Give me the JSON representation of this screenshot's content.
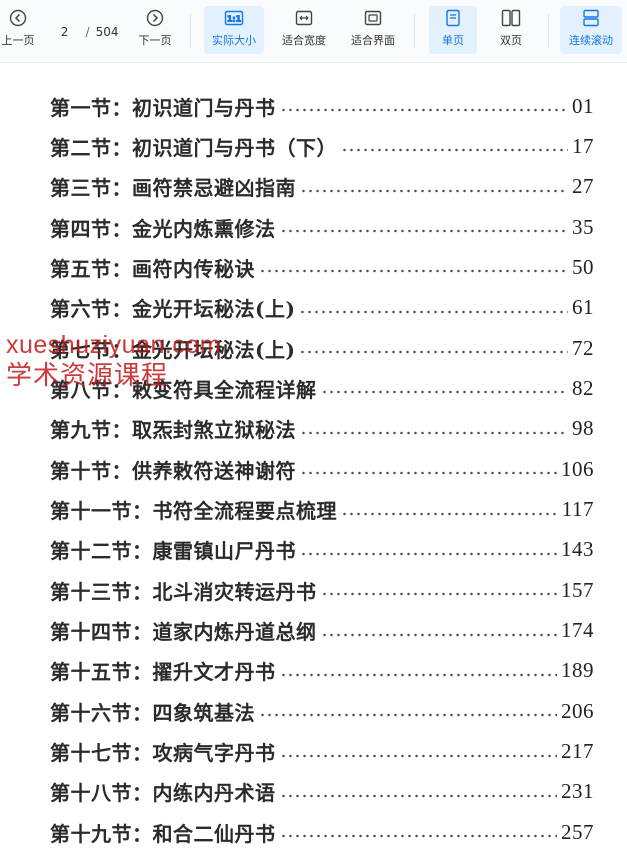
{
  "toolbar": {
    "prev_label": "上一页",
    "next_label": "下一页",
    "current_page": "2",
    "page_separator": "/",
    "total_pages": "504",
    "actual_size_label": "实际大小",
    "actual_size_glyph": "1:1",
    "fit_width_label": "适合宽度",
    "fit_page_label": "适合界面",
    "single_page_label": "单页",
    "double_page_label": "双页",
    "continuous_label": "连续滚动"
  },
  "toc": [
    {
      "title": "第一节：初识道门与丹书",
      "page": "01"
    },
    {
      "title": "第二节：初识道门与丹书（下）",
      "page": "17"
    },
    {
      "title": "第三节：画符禁忌避凶指南",
      "page": "27"
    },
    {
      "title": "第四节：金光内炼熏修法",
      "page": "35"
    },
    {
      "title": "第五节：画符内传秘诀",
      "page": "50"
    },
    {
      "title": "第六节：金光开坛秘法(上)",
      "page": "61"
    },
    {
      "title": "第七节：金光开坛秘法(上)",
      "page": "72"
    },
    {
      "title": "第八节：敕变符具全流程详解",
      "page": "82"
    },
    {
      "title": "第九节：取炁封煞立狱秘法",
      "page": "98"
    },
    {
      "title": "第十节：供养敕符送神谢符",
      "page": "106"
    },
    {
      "title": "第十一节：书符全流程要点梳理",
      "page": "117"
    },
    {
      "title": "第十二节：康雷镇山尸丹书",
      "page": "143"
    },
    {
      "title": "第十三节：北斗消灾转运丹书",
      "page": "157"
    },
    {
      "title": "第十四节：道家内炼丹道总纲",
      "page": "174"
    },
    {
      "title": "第十五节：擢升文才丹书",
      "page": "189"
    },
    {
      "title": "第十六节：四象筑基法",
      "page": "206"
    },
    {
      "title": "第十七节：攻病气字丹书",
      "page": "217"
    },
    {
      "title": "第十八节：内练内丹术语",
      "page": "231"
    },
    {
      "title": "第十九节：和合二仙丹书",
      "page": "257"
    }
  ],
  "watermark": {
    "line1": "xueshuziyuan.com",
    "line2": "学术资源课程"
  },
  "colors": {
    "accent": "#1677e5",
    "active_bg": "#e3f0fd",
    "watermark": "#c41a1a"
  }
}
